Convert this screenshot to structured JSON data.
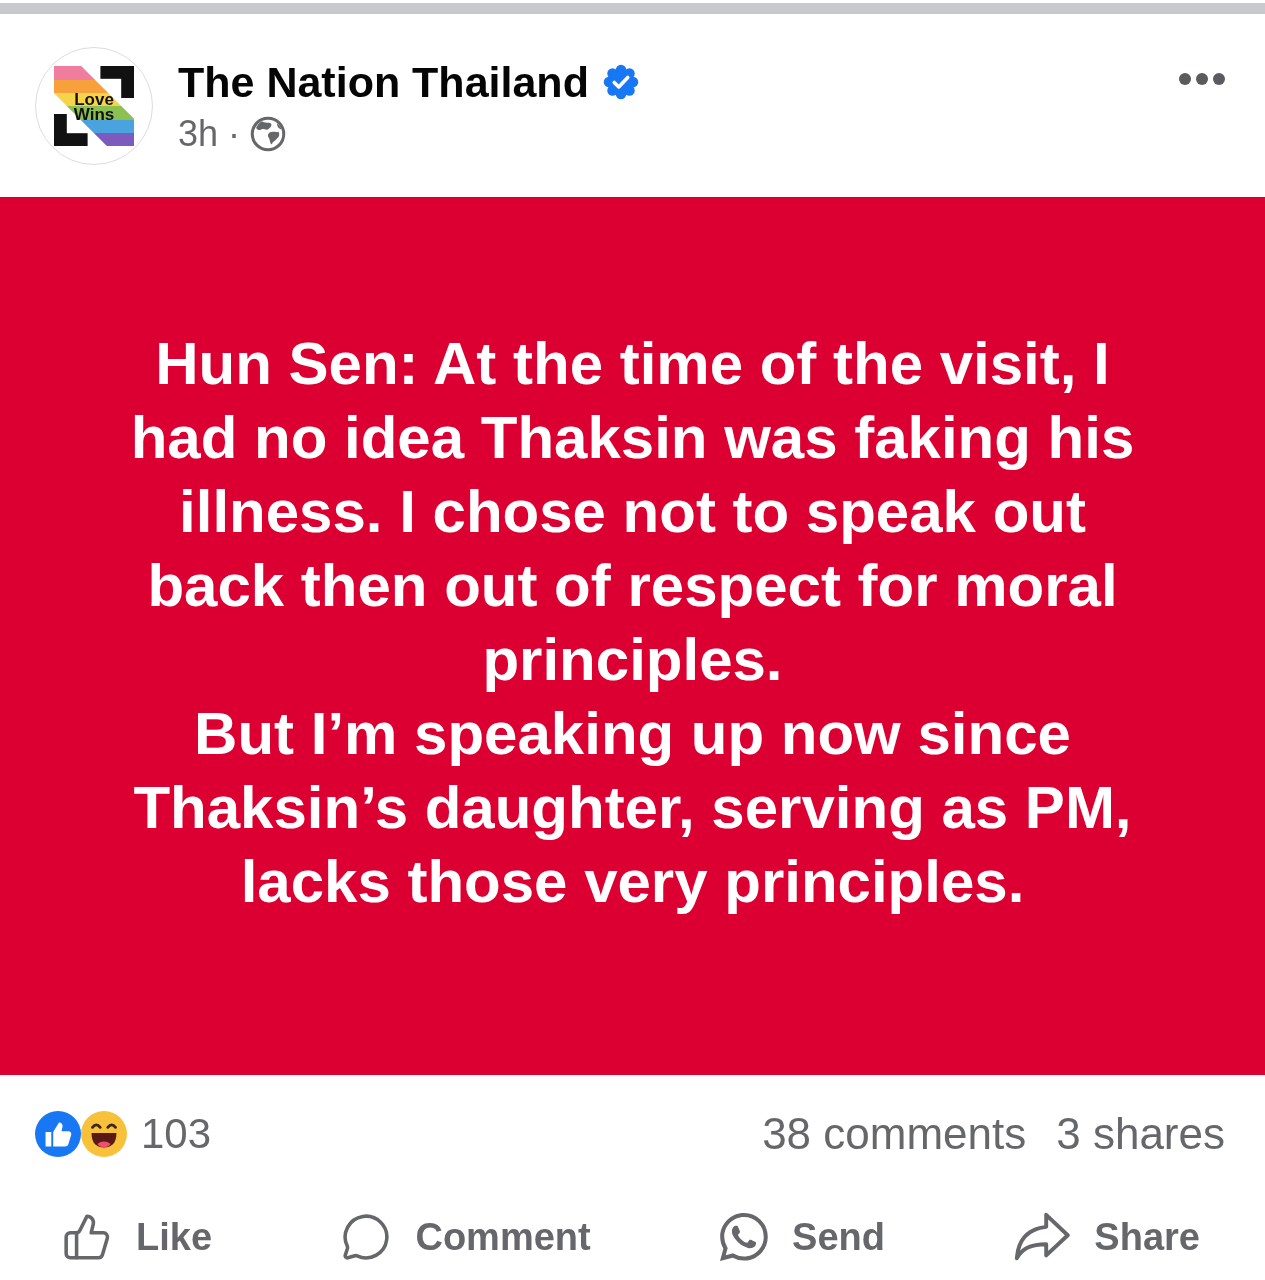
{
  "header": {
    "avatar": {
      "logo_text": [
        "Love",
        "Wins"
      ]
    },
    "page_name": "The Nation Thailand",
    "verified": true,
    "time": "3h",
    "separator": "·"
  },
  "content": {
    "paragraphs": [
      "Hun Sen: At the time of the visit, I had no idea Thaksin was faking his illness. I chose not to speak out back then out of respect for moral principles.",
      "But I’m speaking up now since Thaksin’s daughter, serving as PM, lacks those very principles."
    ]
  },
  "engagement": {
    "reactions": [
      {
        "kind": "like"
      },
      {
        "kind": "haha"
      }
    ],
    "reaction_count": "103",
    "comments": "38 comments",
    "shares": "3 shares"
  },
  "actions": [
    {
      "kind": "like",
      "label": "Like"
    },
    {
      "kind": "comment",
      "label": "Comment"
    },
    {
      "kind": "send",
      "label": "Send"
    },
    {
      "kind": "share",
      "label": "Share"
    }
  ]
}
